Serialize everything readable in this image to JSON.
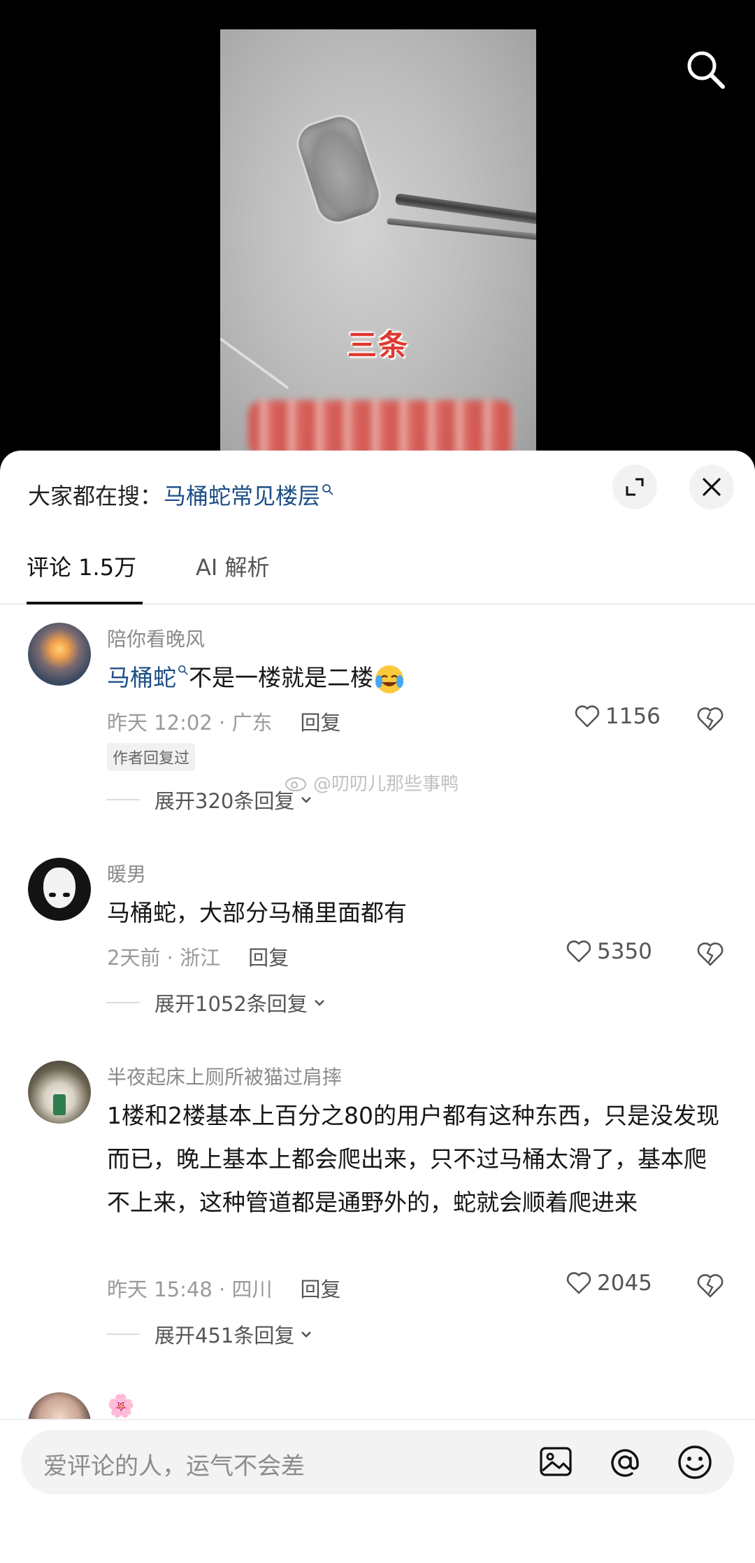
{
  "video": {
    "caption": "三条"
  },
  "header": {
    "trending_prefix": "大家都在搜：",
    "trending_term": "马桶蛇常见楼层"
  },
  "tabs": {
    "comments": "评论 1.5万",
    "ai": "AI 解析"
  },
  "watermark": "@叨叨儿那些事鸭",
  "comments": [
    {
      "username": "陪你看晚风",
      "link_text": "马桶蛇",
      "text": "不是一楼就是二楼",
      "time_location": "昨天 12:02 · 广东",
      "reply": "回复",
      "likes": "1156",
      "author_tag": "作者回复过",
      "expand": "展开320条回复"
    },
    {
      "username": "暖男",
      "text": "马桶蛇，大部分马桶里面都有",
      "time_location": "2天前 · 浙江",
      "reply": "回复",
      "likes": "5350",
      "expand": "展开1052条回复"
    },
    {
      "username": "半夜起床上厕所被猫过肩摔",
      "text": "1楼和2楼基本上百分之80的用户都有这种东西，只是没发现而已，晚上基本上都会爬出来，只不过马桶太滑了，基本爬不上来，这种管道都是通野外的，蛇就会顺着爬进来",
      "time_location": "昨天 15:48 · 四川",
      "reply": "回复",
      "likes": "2045",
      "expand": "展开451条回复"
    }
  ],
  "partial_comment": {
    "username": "🌸"
  },
  "input": {
    "placeholder": "爱评论的人，运气不会差"
  },
  "icons": [
    "search-icon",
    "expand-icon",
    "close-icon",
    "heart-icon",
    "broken-heart-icon",
    "chevron-down-icon",
    "image-icon",
    "at-icon",
    "emoji-icon"
  ]
}
